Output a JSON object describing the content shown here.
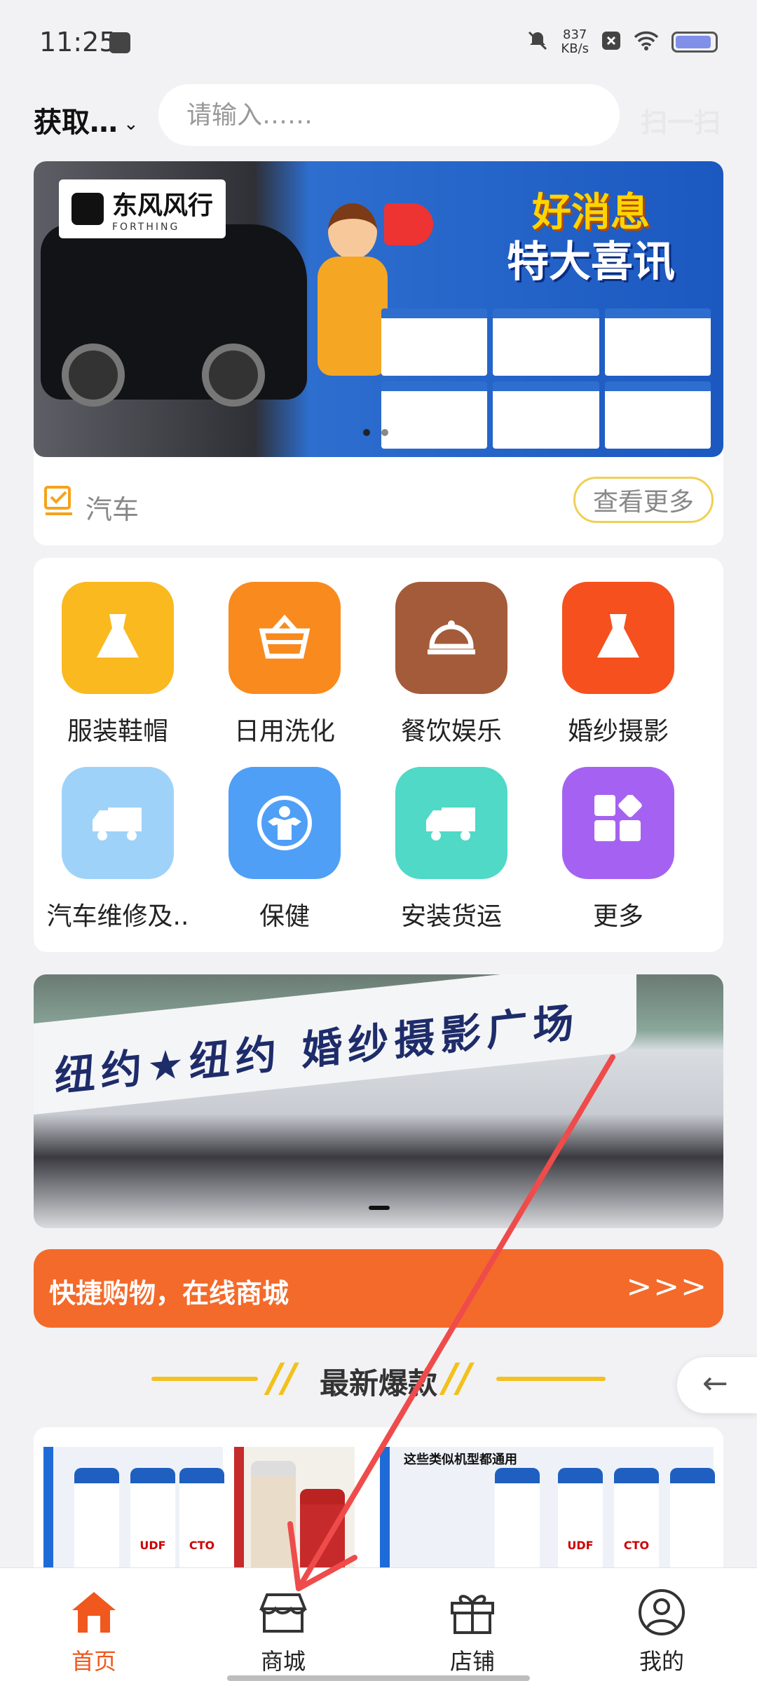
{
  "status_bar": {
    "time": "11:25",
    "net_speed": "837",
    "net_unit": "KB/s"
  },
  "header": {
    "location": "获取…",
    "search_placeholder": "请输入……",
    "scan_label": "扫一扫"
  },
  "top_banner": {
    "brand": "东风风行",
    "brand_en": "FORTHING",
    "headline_1": "好消息",
    "headline_2": "特大喜讯"
  },
  "section": {
    "label": "汽车",
    "more": "查看更多"
  },
  "categories": [
    {
      "label": "服装鞋帽",
      "color": "#f9b91f",
      "icon": "dress-icon"
    },
    {
      "label": "日用洗化",
      "color": "#f98a1e",
      "icon": "basket-icon"
    },
    {
      "label": "餐饮娱乐",
      "color": "#a45b3a",
      "icon": "cloche-icon"
    },
    {
      "label": "婚纱摄影",
      "color": "#f6501f",
      "icon": "wedding-dress-icon"
    },
    {
      "label": "汽车维修及..",
      "color": "#9fd2f8",
      "icon": "truck-icon"
    },
    {
      "label": "保健",
      "color": "#4f9ff7",
      "icon": "fitness-icon"
    },
    {
      "label": "安装货运",
      "color": "#4fd9c6",
      "icon": "truck-icon"
    },
    {
      "label": "更多",
      "color": "#a562f2",
      "icon": "grid-icon"
    }
  ],
  "photo_banner": {
    "sign_text": "纽约★纽约 婚纱摄影广场"
  },
  "shop_banner": {
    "text": "快捷购物，在线商城",
    "arrows": ">>>"
  },
  "hot": {
    "title": "最新爆款"
  },
  "products": {
    "note": "这些类似机型都通用",
    "labels": [
      "UDF",
      "CTO"
    ]
  },
  "tabbar": {
    "items": [
      {
        "label": "首页",
        "icon": "home-icon",
        "active": true
      },
      {
        "label": "商城",
        "icon": "store-icon",
        "active": false
      },
      {
        "label": "店铺",
        "icon": "gift-icon",
        "active": false
      },
      {
        "label": "我的",
        "icon": "profile-icon",
        "active": false
      }
    ]
  },
  "colors": {
    "accent": "#f0581e",
    "shop_banner": "#f46a2a",
    "hot_line": "#f2c11c",
    "more_border": "#f0cf55"
  }
}
